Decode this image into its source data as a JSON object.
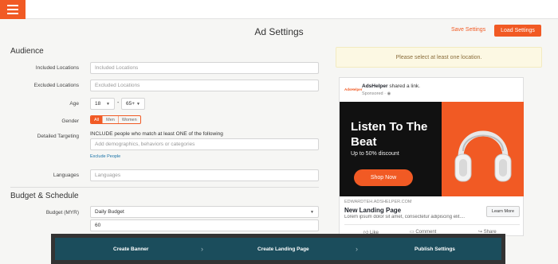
{
  "header": {
    "menu_icon": "hamburger-icon",
    "title": "Ad Settings",
    "save_label": "Save Settings",
    "load_label": "Load Settings"
  },
  "audience": {
    "heading": "Audience",
    "included_label": "Included Locations",
    "included_placeholder": "Included Locations",
    "excluded_label": "Excluded Locations",
    "excluded_placeholder": "Excluded Locations",
    "age_label": "Age",
    "age_min": "18",
    "age_sep": "-",
    "age_max": "65+",
    "gender_label": "Gender",
    "gender_options": [
      "All",
      "Men",
      "Women"
    ],
    "targeting_label": "Detailed Targeting",
    "targeting_hint": "INCLUDE people who match at least ONE of the following",
    "targeting_placeholder": "Add demographics, behaviors or categories",
    "exclude_people": "Exclude People",
    "languages_label": "Languages",
    "languages_placeholder": "Languages"
  },
  "budget": {
    "heading": "Budget & Schedule",
    "budget_label": "Budget (MYR)",
    "budget_type": "Daily Budget",
    "budget_value": "60"
  },
  "alert": "Please select at least one location.",
  "preview": {
    "logo_text": "AdsHelper",
    "advertiser": "AdsHelper",
    "shared": "shared a link.",
    "sponsored": "Sponsored",
    "hero_title_line1": "Listen To The",
    "hero_title_line2": "Beat",
    "hero_sub": "Up to 50% discount",
    "hero_button": "Shop Now",
    "domain": "EDWARDTEH.ADSHELPER.COM",
    "title": "New Landing Page",
    "desc": "Lorem ipsum dolor sit amet, consectetur adipiscing elit....",
    "learn_more": "Learn More",
    "like": "Like",
    "comment": "Comment",
    "share": "Share",
    "accent": "#f15a24"
  },
  "wizard": {
    "steps": [
      "Create Banner",
      "Create Landing Page",
      "Publish Settings"
    ],
    "bg": "#1b4d5c"
  }
}
